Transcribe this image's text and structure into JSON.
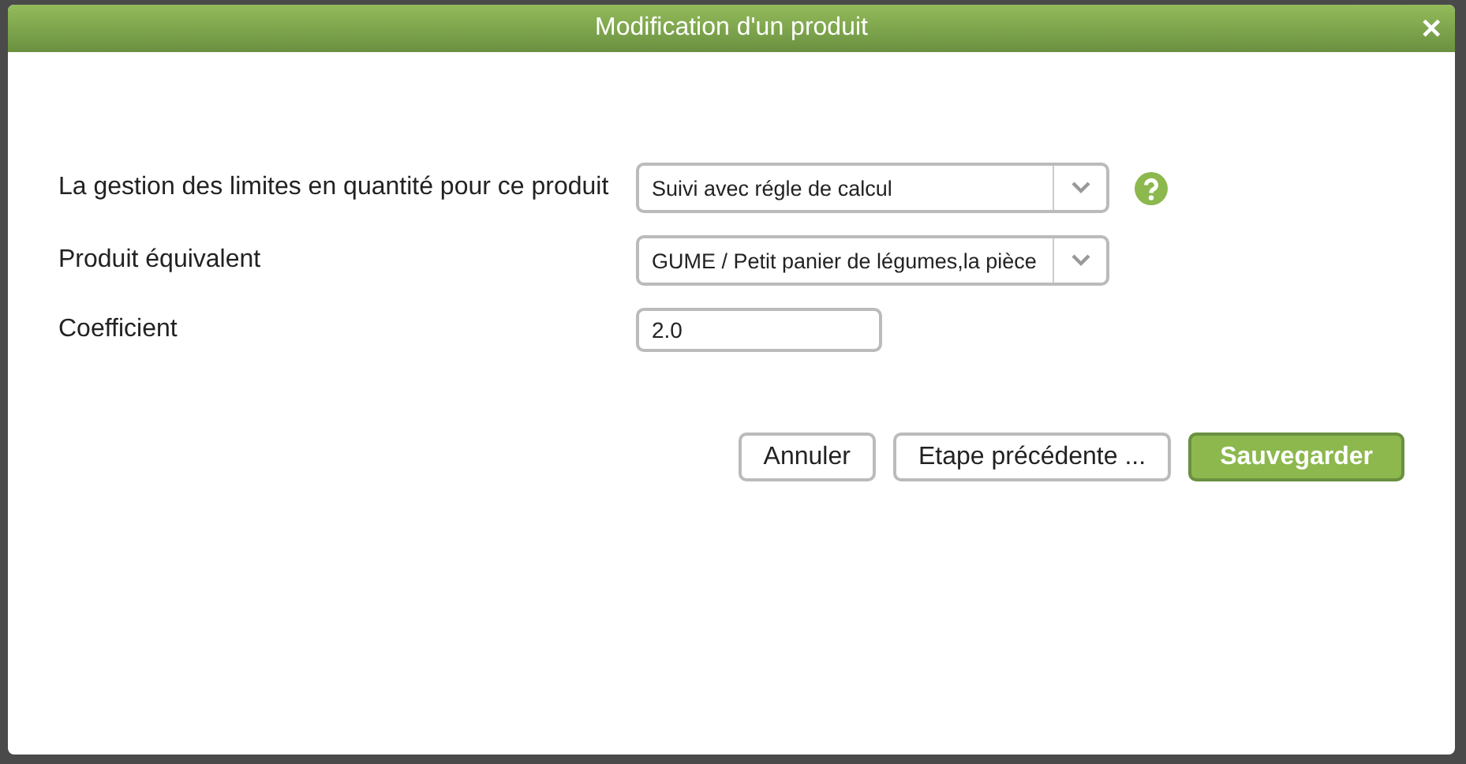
{
  "dialog": {
    "title": "Modification d'un produit",
    "close": "✕"
  },
  "fields": [
    {
      "kind": "select",
      "label": "La gestion des limites en quantité pour ce produit",
      "value": "Suivi avec régle de calcul",
      "help": true
    },
    {
      "kind": "select",
      "label": "Produit équivalent",
      "value": "GUME / Petit panier de légumes,la pièce",
      "help": false
    },
    {
      "kind": "text",
      "label": "Coefficient",
      "value": "2.0",
      "help": false
    }
  ],
  "buttons": [
    {
      "label": "Annuler",
      "primary": false
    },
    {
      "label": "Etape précédente ...",
      "primary": false
    },
    {
      "label": "Sauvegarder",
      "primary": true
    }
  ]
}
